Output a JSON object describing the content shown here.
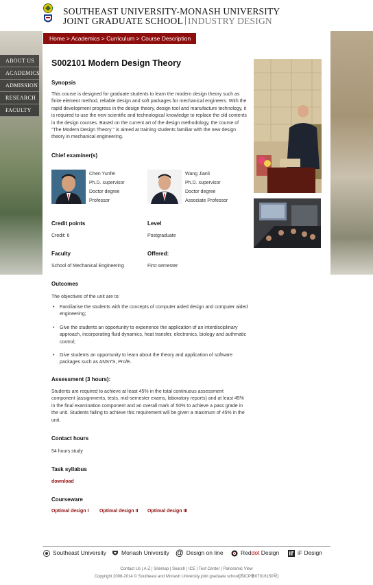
{
  "header": {
    "title_line1": "SOUTHEAST UNIVERSITY-MONASH UNIVERSITY",
    "title_line2_dark": "JOINT GRADUATE SCHOOL",
    "title_line2_light": "INDUSTRY DESIGN"
  },
  "nav": [
    "ABOUT US",
    "ACADEMICS",
    "ADMISSION",
    "RESEARCH",
    "FACULTY"
  ],
  "breadcrumb": {
    "home": "Home",
    "sep": " > ",
    "academics": "Academics",
    "curriculum": "Curriculum",
    "current": "Course Description"
  },
  "course": {
    "title": "S002101 Modern Design Theory",
    "synopsis_h": "Synopsis",
    "synopsis": "This course is designed for graduate students to learn the modern design theory such as finite element method, reliable design and soft packages for mechanical engineers. With the rapid development progress in the design theory, design tool and manufacture technology, it is required to use the new scientific and technological knowledge to replace the old contents in the design courses. Based on the current art of the design methodology, the course of \"The Modern Design Theory \" is aimed at training students familiar with the new design theory in mechanical engineering.",
    "examiner_h": "Chief examiner(s)",
    "examiners": [
      {
        "name": "Chen Yunfei",
        "role": "Ph.D. supervisor",
        "degree": "Doctor degree",
        "title": "Professor"
      },
      {
        "name": "Wang Jianli",
        "role": "Ph.D. supervisor",
        "degree": "Doctor degree",
        "title": "Associate Professor"
      }
    ],
    "credit_h": "Credit points",
    "credit": "Credit: 6",
    "level_h": "Level",
    "level": "Postgraduate",
    "faculty_h": "Faculty",
    "faculty": "School of Mechanical Engineering",
    "offered_h": "Offered:",
    "offered": "First semester",
    "outcomes_h": "Outcomes",
    "outcomes_intro": "The objectives of the unit are to:",
    "outcomes": [
      "Familiarise the students with the concepts of computer aided design and computer aided engineering;",
      "Give the students an opportunity to experience the application of an interdisciplinary approach, incorporating fluid dynamics, heat transfer, electronics, biology and authmatic control;",
      "Give students an opportunity to learn about the theory and application of software packages such as ANSYS, Pro/E."
    ],
    "assessment_h": "Assessment (3 hours):",
    "assessment": "Students are required to achieve at least 45% in the total continuous assessment component (assignments, tests, mid-semester exams, laboratory reports) and at least 45% in the final examination component and an overall mark of 50% to achieve a pass grade in the unit. Students failing to achieve this requirement will be given a maximum of 45% in the unit.",
    "contact_h": "Contact hours",
    "contact": "54 hours study",
    "syllabus_h": "Task syllabus",
    "syllabus_link": "download",
    "courseware_h": "Courseware",
    "courseware": [
      "Optimal design I",
      "Optimal design II",
      "Optimal design III"
    ]
  },
  "footer": {
    "links": [
      "Southeast University",
      "Monash University",
      "Design on line",
      "Design",
      "iF Design"
    ],
    "reddot_red": "dot",
    "reddot_prefix": "Red",
    "bottom_links": "Contact Us | A-Z | Sitemap | Search | ICE | Test Center | Panoramic View",
    "copyright": "Copyright 2008-2014 © Southeast and Monash University joint graduate school[苏ICP备07016150号]"
  },
  "colors": {
    "accent": "#8e0d0d",
    "nav_bg": "#2a2a2a"
  }
}
